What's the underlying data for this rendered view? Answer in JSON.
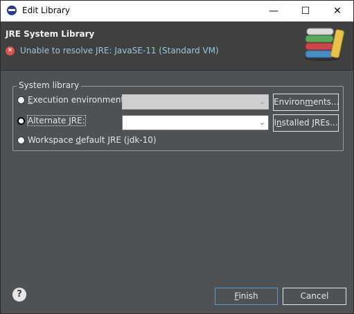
{
  "window": {
    "title": "Edit Library"
  },
  "window_controls": {
    "minimize": "—",
    "maximize": "☐",
    "close": "✕"
  },
  "header": {
    "title": "JRE System Library",
    "error_message": "Unable to resolve JRE: JavaSE-11 (Standard VM)"
  },
  "group": {
    "legend": "System library",
    "options": [
      {
        "label_pre": "",
        "mnemonic": "E",
        "label_post": "xecution environment:",
        "selected": false
      },
      {
        "label_pre": "Alternate ",
        "mnemonic": "J",
        "label_post": "RE:",
        "selected": true
      },
      {
        "label_pre": "Workspace ",
        "mnemonic": "d",
        "label_post": "efault JRE (jdk-10)",
        "selected": false
      }
    ],
    "environments_button": {
      "pre": "Environ",
      "mnemonic": "m",
      "post": "ents..."
    },
    "installed_jres_button": {
      "pre": "I",
      "mnemonic": "n",
      "post": "stalled JREs..."
    }
  },
  "footer": {
    "help": "?",
    "finish": {
      "pre": "",
      "mnemonic": "F",
      "post": "inish"
    },
    "cancel": "Cancel"
  }
}
